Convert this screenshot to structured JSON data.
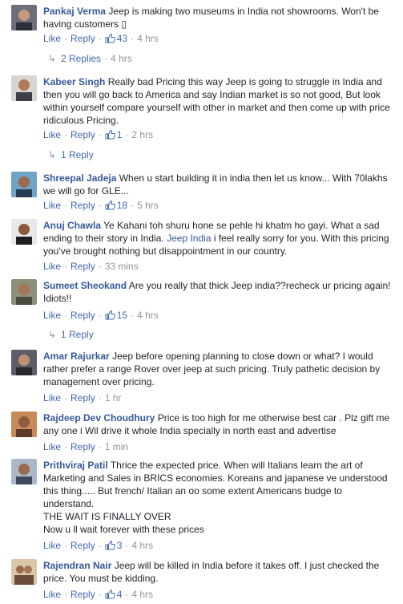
{
  "actions": {
    "like": "Like",
    "reply": "Reply",
    "separator": "·"
  },
  "comments": [
    {
      "author": "Pankaj Verma",
      "text": "Jeep is making two museums in India not showrooms. Won't be having customers ",
      "tail_glyph": "▯",
      "likes": "43",
      "time": "4 hrs",
      "replies": "2 Replies",
      "replies_time": "4 hrs"
    },
    {
      "author": "Kabeer Singh",
      "text": "Really bad Pricing this way Jeep is going to struggle in India and then you will go back to America and say Indian market is so not good, But look within yourself compare yourself with other in market and then come up with price ridiculous Pricing.",
      "likes": "1",
      "time": "2 hrs",
      "replies": "1 Reply"
    },
    {
      "author": "Shreepal Jadeja",
      "text": "When u start building it in india then let us know... With 70lakhs we will go for GLE...",
      "likes": "18",
      "time": "5 hrs"
    },
    {
      "author": "Anuj Chawla",
      "text_before": "Ye Kahani toh shuru hone se pehle hi khatm ho gayi. What a sad ending to their story in India.",
      "mention": "Jeep India",
      "text_after": "i feel really sorry for you. With this pricing you've brought nothing but disappointment in our country.",
      "time": "33 mins"
    },
    {
      "author": "Sumeet Sheokand",
      "text": "Are you really that thick Jeep india??recheck ur pricing again! Idiots!!",
      "likes": "15",
      "time": "4 hrs",
      "replies": "1 Reply"
    },
    {
      "author": "Amar Rajurkar",
      "text": "Jeep before opening planning to close down or what? I would rather prefer a range Rover over jeep at such pricing. Truly pathetic decision by management over pricing.",
      "time": "1 hr"
    },
    {
      "author": "Rajdeep Dev Choudhury",
      "text": "Price is too high for me otherwise best car . Plz gift me any one i Wil drive it whole India specially in north east and advertise",
      "time": "1 min"
    },
    {
      "author": "Prithviraj Patil",
      "text": "Thrice the expected price. When will Italians learn the art of Marketing and Sales in BRICS economies. Koreans and japanese ve understood this thing..... But french/ Italian an oo some extent Americans budge to understand.",
      "line2": "THE WAIT IS FINALLY OVER",
      "line3": "Now u ll wait forever with these prices",
      "likes": "3",
      "time": "4 hrs"
    },
    {
      "author": "Rajendran Nair",
      "text": "Jeep will be killed in India before it takes off. I just checked the price. You must be kidding.",
      "likes": "4",
      "time": "4 hrs"
    }
  ],
  "colors": {
    "link": "#365899",
    "action": "#4267b2",
    "meta": "#90949c",
    "text": "#1d2129"
  },
  "icons": {
    "like": "thumbs-up-icon",
    "reply_arrow": "reply-arrow-icon"
  }
}
